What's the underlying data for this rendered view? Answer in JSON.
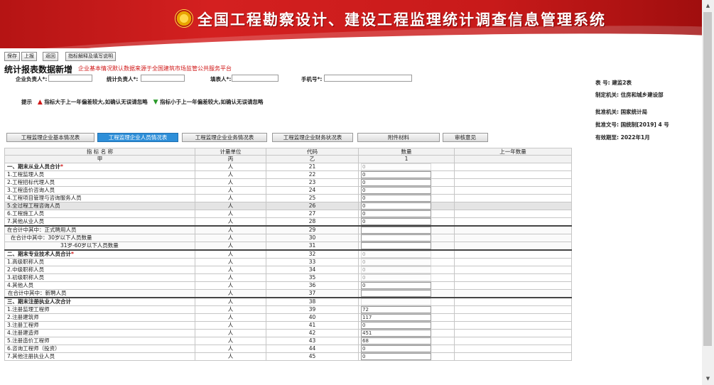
{
  "header": {
    "system_title": "全国工程勘察设计、建设工程监理统计调查信息管理系统"
  },
  "toolbar": {
    "save": "保存",
    "submit": "上报",
    "back": "返回",
    "help": "指标解释及填写说明"
  },
  "page": {
    "title": "统计报表数据新增",
    "source_note": "企业基本情况默认数据来源于全国建筑市场监管公共服务平台"
  },
  "fields": {
    "enterprise_head": "企业负责人",
    "stats_head": "统计负责人",
    "filler": "填表人",
    "phone": "手机号",
    "required_mark": "*:"
  },
  "hint": {
    "label": "提示",
    "up_icon": "▲",
    "up_text": "指标大于上一年偏差较大,如确认无误请忽略",
    "down_icon": "▼",
    "down_text": "指标小于上一年偏差较大,如确认无误请忽略"
  },
  "meta": {
    "form_no": "表 号:  建监2表",
    "issuer": "制定机关:  住房和城乡建设部",
    "approver": "批准机关:  国家统计局",
    "approval_no": "批准文号:  国统制[2019] 4 号",
    "valid_until": "有效期至:  2022年1月"
  },
  "tabs": [
    "工程监理企业基本情况表",
    "工程监理企业人员情况表",
    "工程监理企业业务情况表",
    "工程监理企业财务状况表",
    "附件材料",
    "审核意见"
  ],
  "table": {
    "headers": [
      "指 标 名 称",
      "计量单位",
      "代码",
      "数量",
      "上一年数量"
    ],
    "header_codes": [
      "甲",
      "丙",
      "乙",
      "1",
      ""
    ],
    "rows": [
      {
        "name": "一、期末从业人员合计",
        "star": "*",
        "unit": "人",
        "code": "21",
        "qty": "0",
        "ro": true
      },
      {
        "name": "1.工程监理人员",
        "unit": "人",
        "code": "22",
        "qty": "0"
      },
      {
        "name": "2.工程招标代理人员",
        "unit": "人",
        "code": "23",
        "qty": "0"
      },
      {
        "name": "3.工程造价咨询人员",
        "unit": "人",
        "code": "24",
        "qty": "0"
      },
      {
        "name": "4.工程项目管理与咨询服务人员",
        "unit": "人",
        "code": "25",
        "qty": "0"
      },
      {
        "name": "5.全过程工程咨询人员",
        "unit": "人",
        "code": "26",
        "qty": "0"
      },
      {
        "name": "6.工程施工人员",
        "unit": "人",
        "code": "27",
        "qty": "0"
      },
      {
        "name": "7.其他从业人员",
        "unit": "人",
        "code": "28",
        "qty": "0"
      },
      {
        "name": "在合计中其中：正式聘用人员",
        "unit": "人",
        "code": "29",
        "qty": ""
      },
      {
        "name": "在合计中其中：30岁以下人员数量",
        "unit": "人",
        "code": "30",
        "qty": ""
      },
      {
        "name": "31岁-60岁以下人员数量",
        "unit": "人",
        "code": "31",
        "qty": ""
      },
      {
        "name": "二、期末专业技术人员合计",
        "star": "*",
        "unit": "人",
        "code": "32",
        "qty": "0",
        "ro": true
      },
      {
        "name": "1.高级职称人员",
        "unit": "人",
        "code": "33",
        "qty": "0",
        "ro": true
      },
      {
        "name": "2.中级职称人员",
        "unit": "人",
        "code": "34",
        "qty": "0",
        "ro": true
      },
      {
        "name": "3.初级职称人员",
        "unit": "人",
        "code": "35",
        "qty": "0",
        "ro": true
      },
      {
        "name": "4.其他人员",
        "unit": "人",
        "code": "36",
        "qty": "0"
      },
      {
        "name": "在合计中其中：新聘人员",
        "unit": "人",
        "code": "37",
        "qty": ""
      },
      {
        "name": "三、期末注册执业人次合计",
        "unit": "人",
        "code": "38",
        "qty": "",
        "ro": true
      },
      {
        "name": "1.注册监理工程师",
        "unit": "人",
        "code": "39",
        "qty": "72"
      },
      {
        "name": "2.注册建筑师",
        "unit": "人",
        "code": "40",
        "qty": "117"
      },
      {
        "name": "3.注册工程师",
        "unit": "人",
        "code": "41",
        "qty": "0"
      },
      {
        "name": "4.注册建造师",
        "unit": "人",
        "code": "42",
        "qty": "451"
      },
      {
        "name": "5.注册造价工程师",
        "unit": "人",
        "code": "43",
        "qty": "68"
      },
      {
        "name": "6.咨询工程师（投资）",
        "unit": "人",
        "code": "44",
        "qty": "0"
      },
      {
        "name": "7.其他注册执业人员",
        "unit": "人",
        "code": "45",
        "qty": "0"
      }
    ]
  },
  "colors": {
    "banner_red": "#c81a1a",
    "active_tab": "#2e8fd9",
    "warning_red": "#d01818",
    "hint_green": "#2a9a2a"
  },
  "icons": {
    "emblem": "national-emblem-icon",
    "up": "up-arrow-icon",
    "down": "down-arrow-icon"
  }
}
